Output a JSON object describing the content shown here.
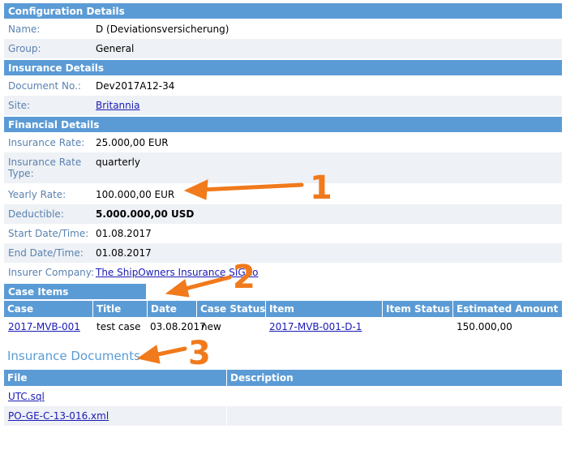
{
  "config": {
    "header": "Configuration Details",
    "name_label": "Name:",
    "name_value": "D (Deviationsversicherung)",
    "group_label": "Group:",
    "group_value": "General"
  },
  "insurance": {
    "header": "Insurance Details",
    "doc_label": "Document No.:",
    "doc_value": "Dev2017A12-34",
    "site_label": "Site:",
    "site_value": "Britannia"
  },
  "financial": {
    "header": "Financial Details",
    "rate_label": "Insurance Rate:",
    "rate_value": "25.000,00 EUR",
    "rate_type_label_1": "Insurance Rate",
    "rate_type_label_2": "Type:",
    "rate_type_value": "quarterly",
    "yearly_label": "Yearly Rate:",
    "yearly_value": "100.000,00 EUR",
    "deductible_label": "Deductible:",
    "deductible_value": "5.000.000,00 USD",
    "start_label": "Start Date/Time:",
    "start_value": "01.08.2017",
    "end_label": "End Date/Time:",
    "end_value": "01.08.2017",
    "insurer_label": "Insurer Company:",
    "insurer_value": "The ShipOwners Insurance SIGCo"
  },
  "case_items": {
    "header": "Case Items",
    "columns": [
      "Case",
      "Title",
      "Date",
      "Case Status",
      "Item",
      "Item Status",
      "Estimated Amount"
    ],
    "rows": [
      {
        "case": "2017-MVB-001",
        "title": "test case",
        "date": "03.08.2017",
        "status": "new",
        "item": "2017-MVB-001-D-1",
        "item_status": "",
        "amount": "150.000,00"
      }
    ]
  },
  "documents": {
    "title": "Insurance Documents",
    "columns": [
      "File",
      "Description"
    ],
    "rows": [
      {
        "file": "UTC.sql",
        "description": ""
      },
      {
        "file": "PO-GE-C-13-016.xml",
        "description": ""
      }
    ]
  },
  "annotations": {
    "n1": "1",
    "n2": "2",
    "n3": "3",
    "color": "#f07a1c"
  },
  "colors": {
    "header_bg": "#5b9bd5",
    "label": "#5a82b0",
    "link": "#1a1ab5",
    "alt_row": "#eef1f5"
  }
}
